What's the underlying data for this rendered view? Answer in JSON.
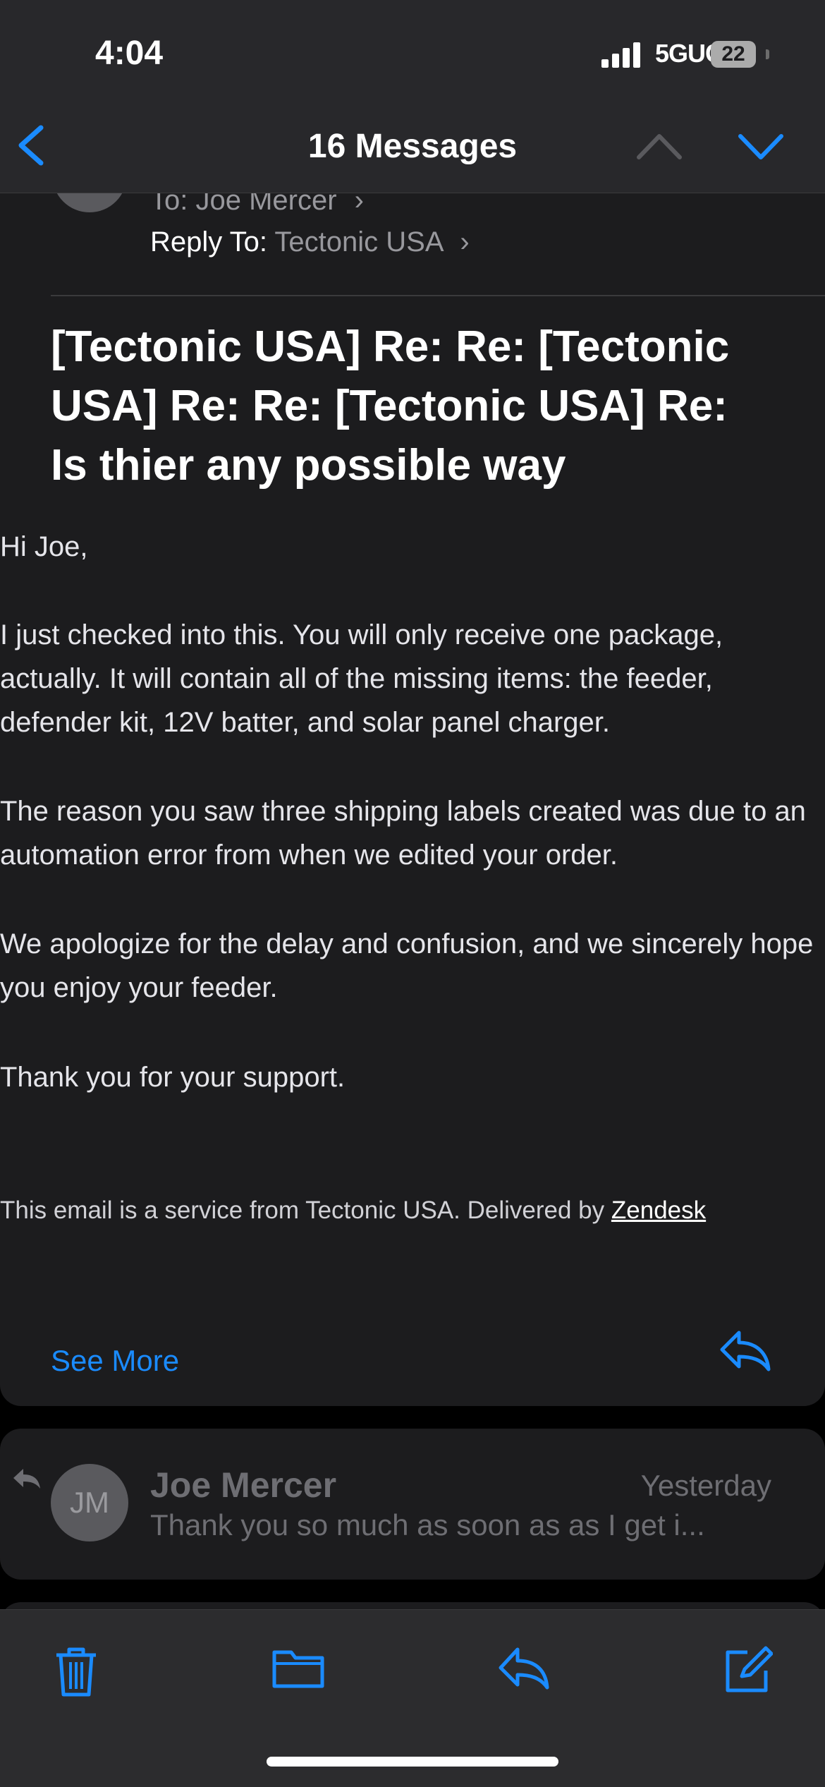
{
  "status_bar": {
    "time": "4:04",
    "network": "5GUC",
    "battery": "22"
  },
  "nav": {
    "title": "16 Messages"
  },
  "email": {
    "to_label": "To:",
    "to_value": "Joe Mercer",
    "reply_to_label": "Reply To:",
    "reply_to_value": "Tectonic USA",
    "subject": "[Tectonic USA] Re: Re: [Tectonic USA] Re: Re: [Tectonic USA] Re: Is thier any possible way",
    "body": [
      "Hi Joe,",
      "I just checked into this. You will only receive one package, actually. It will contain all of the missing items:  the feeder, defender kit, 12V batter, and solar panel charger.",
      "The reason you saw three shipping labels created was due to an automation error from when we edited your order.",
      "We apologize for the delay and confusion, and we sincerely hope you enjoy your feeder.",
      "Thank you for your support."
    ],
    "footer": "This email is a service from Tectonic USA. Delivered by",
    "footer_link": "Zendesk",
    "see_more": "See More"
  },
  "next_message": {
    "avatar_initials": "JM",
    "sender": "Joe Mercer",
    "date": "Yesterday",
    "snippet": "Thank you so much as soon as as I get i..."
  },
  "toolbar": {
    "icons": [
      "trash-icon",
      "folder-icon",
      "reply-icon",
      "compose-icon"
    ]
  },
  "colors": {
    "accent": "#1a8bff",
    "background": "#000000",
    "card": "#1c1c1e"
  }
}
